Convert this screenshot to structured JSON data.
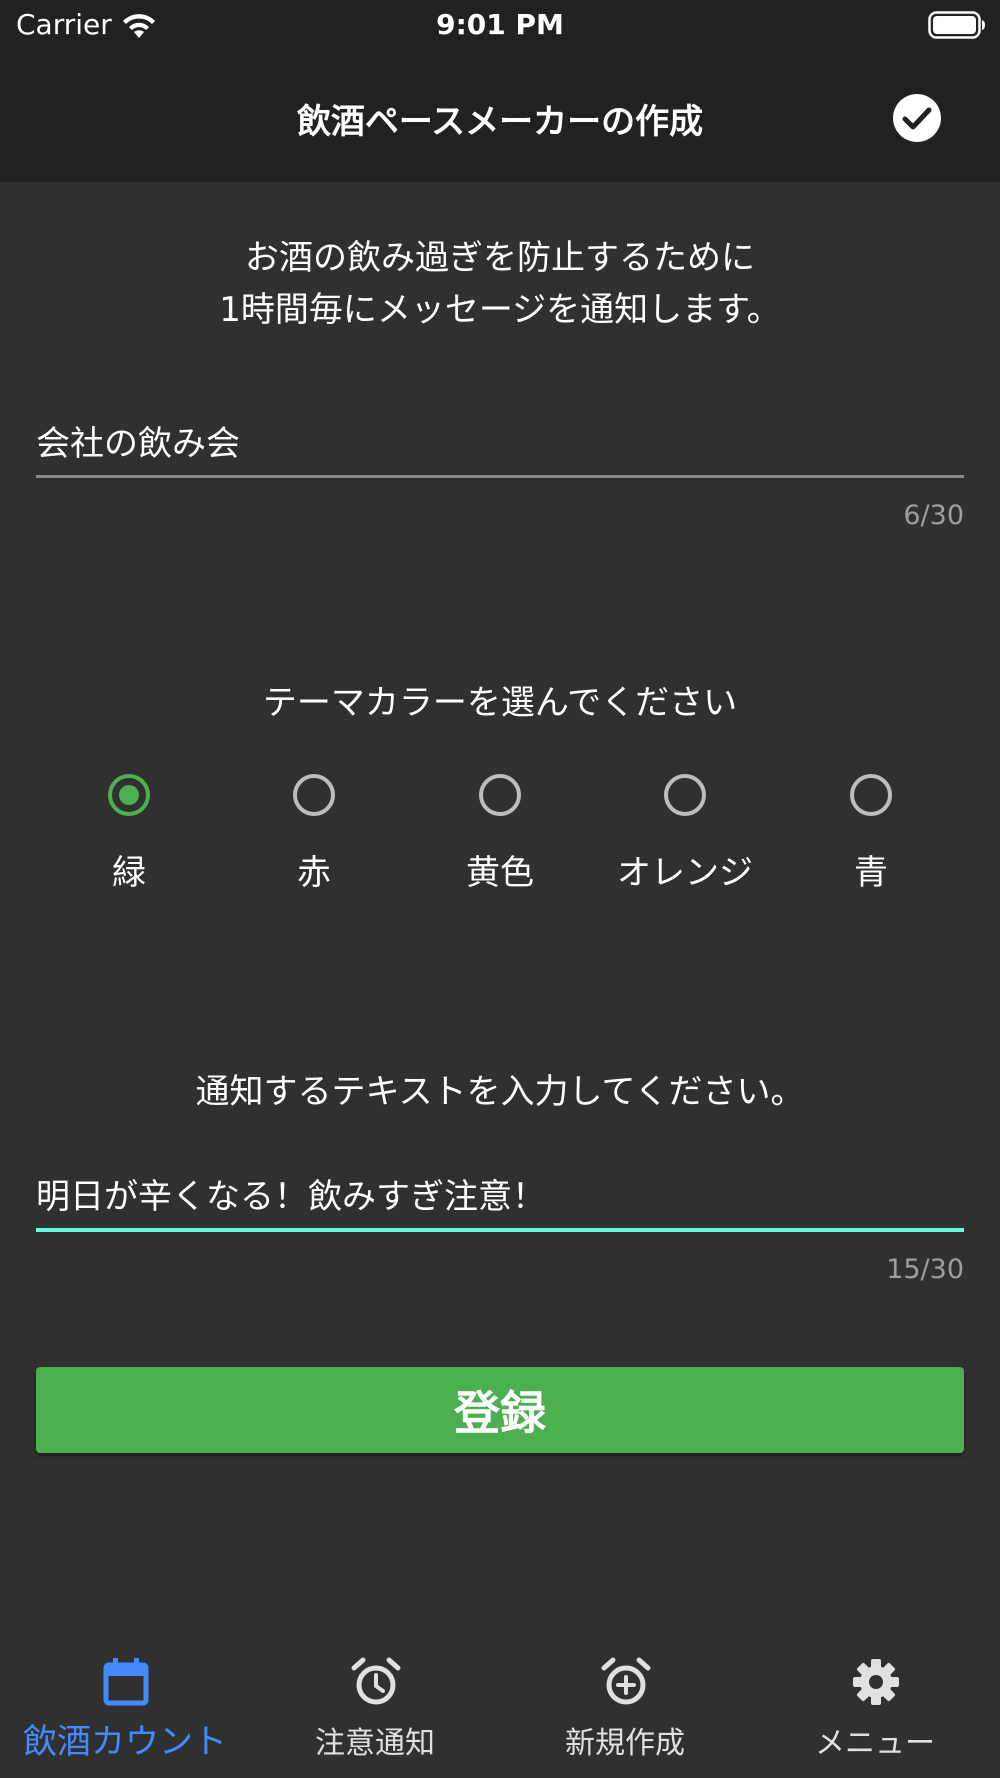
{
  "status_bar": {
    "carrier": "Carrier",
    "time": "9:01 PM"
  },
  "app_bar": {
    "title": "飲酒ペースメーカーの作成"
  },
  "description": {
    "line1": "お酒の飲み過ぎを防止するために",
    "line2": "1時間毎にメッセージを通知します。"
  },
  "name_field": {
    "value": "会社の飲み会",
    "counter": "6/30"
  },
  "theme": {
    "heading": "テーマカラーを選んでください",
    "options": [
      {
        "label": "緑",
        "selected": true
      },
      {
        "label": "赤",
        "selected": false
      },
      {
        "label": "黄色",
        "selected": false
      },
      {
        "label": "オレンジ",
        "selected": false
      },
      {
        "label": "青",
        "selected": false
      }
    ],
    "selected_color": "#4caf50"
  },
  "notify": {
    "heading": "通知するテキストを入力してください。",
    "value": "明日が辛くなる！飲みすぎ注意！",
    "counter": "15/30"
  },
  "register_button": {
    "label": "登録"
  },
  "bottom_nav": {
    "items": [
      {
        "label": "飲酒カウント",
        "icon": "calendar-icon",
        "active": true
      },
      {
        "label": "注意通知",
        "icon": "alarm-icon",
        "active": false
      },
      {
        "label": "新規作成",
        "icon": "alarm-add-icon",
        "active": false
      },
      {
        "label": "メニュー",
        "icon": "gear-icon",
        "active": false
      }
    ],
    "active_color": "#448aff"
  }
}
